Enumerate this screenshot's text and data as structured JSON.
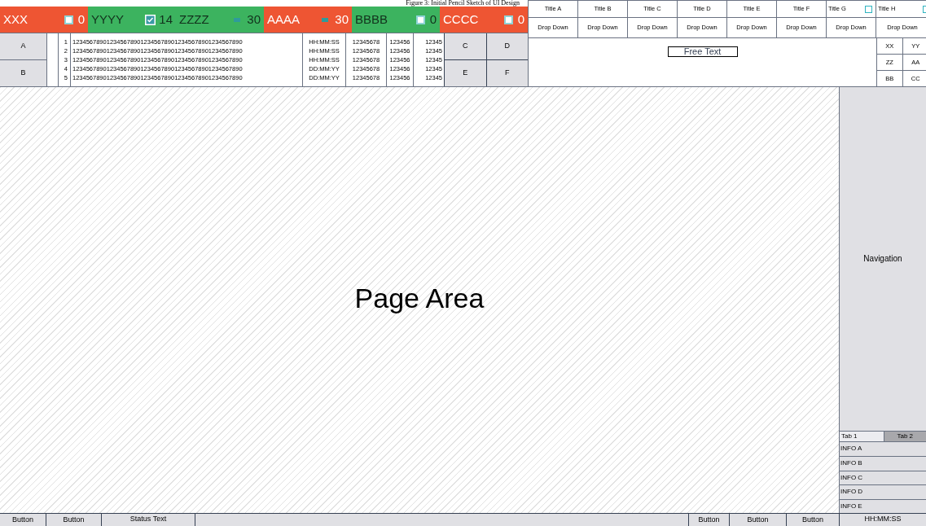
{
  "caption": "Figure 3: Initial Pencil Sketch of UI Design",
  "status_tiles": [
    {
      "label": "XXX",
      "kind": "checkbox",
      "checked": false,
      "count": "0",
      "color": "#ee5533"
    },
    {
      "label": "YYYY",
      "kind": "checkbox",
      "checked": true,
      "count": "14",
      "color": "#3cb35f"
    },
    {
      "label": "ZZZZ",
      "kind": "minus",
      "count": "30",
      "color": "#3cb35f"
    },
    {
      "label": "AAAA",
      "kind": "minus",
      "count": "30",
      "color": "#ee5533"
    },
    {
      "label": "BBBB",
      "kind": "checkbox",
      "checked": false,
      "count": "0",
      "color": "#3cb35f"
    },
    {
      "label": "CCCC",
      "kind": "checkbox",
      "checked": false,
      "count": "0",
      "color": "#ee5533"
    }
  ],
  "left_buttons": [
    "A",
    "B"
  ],
  "right_buttons": [
    "C",
    "D",
    "E",
    "F"
  ],
  "rows": [
    {
      "number": "1",
      "text": "12345678901234567890123456789012345678901234567890",
      "time": "HH:MM:SS",
      "col_a": "12345678",
      "col_b": "123456",
      "col_c": "12345"
    },
    {
      "number": "2",
      "text": "12345678901234567890123456789012345678901234567890",
      "time": "HH:MM:SS",
      "col_a": "12345678",
      "col_b": "123456",
      "col_c": "12345"
    },
    {
      "number": "3",
      "text": "12345678901234567890123456789012345678901234567890",
      "time": "HH:MM:SS",
      "col_a": "12345678",
      "col_b": "123456",
      "col_c": "12345"
    },
    {
      "number": "4",
      "text": "12345678901234567890123456789012345678901234567890",
      "time": "DD:MM:YY",
      "col_a": "12345678",
      "col_b": "123456",
      "col_c": "12345"
    },
    {
      "number": "5",
      "text": "12345678901234567890123456789012345678901234567890",
      "time": "DD:MM:YY",
      "col_a": "12345678",
      "col_b": "123456",
      "col_c": "12345"
    }
  ],
  "filters": [
    {
      "title": "Title A",
      "dropdown": "Drop Down",
      "kind": "plain"
    },
    {
      "title": "Title B",
      "dropdown": "Drop Down",
      "kind": "plain"
    },
    {
      "title": "Title C",
      "dropdown": "Drop Down",
      "kind": "plain"
    },
    {
      "title": "Title D",
      "dropdown": "Drop Down",
      "kind": "plain"
    },
    {
      "title": "Title E",
      "dropdown": "Drop Down",
      "kind": "plain"
    },
    {
      "title": "Title F",
      "dropdown": "Drop Down",
      "kind": "plain"
    },
    {
      "title": "Title G",
      "dropdown": "Drop Down",
      "kind": "checkbox",
      "checked": false
    },
    {
      "title": "Title H",
      "dropdown": "Drop Down",
      "kind": "checkbox",
      "checked": false
    }
  ],
  "free_text": "Free Text",
  "mini_grid": [
    "XX",
    "YY",
    "ZZ",
    "AA",
    "BB",
    "CC"
  ],
  "page_area": "Page Area",
  "navigation": {
    "label": "Navigation",
    "tabs": [
      {
        "label": "Tab 1",
        "selected": true
      },
      {
        "label": "Tab 2",
        "selected": false
      }
    ],
    "info": [
      "INFO A",
      "INFO B",
      "INFO C",
      "INFO D",
      "INFO E"
    ]
  },
  "footer": {
    "left_buttons": [
      "Button",
      "Button"
    ],
    "status_text": "Status Text",
    "right_buttons": [
      "Button",
      "Button",
      "Button"
    ],
    "clock": "HH:MM:SS"
  }
}
